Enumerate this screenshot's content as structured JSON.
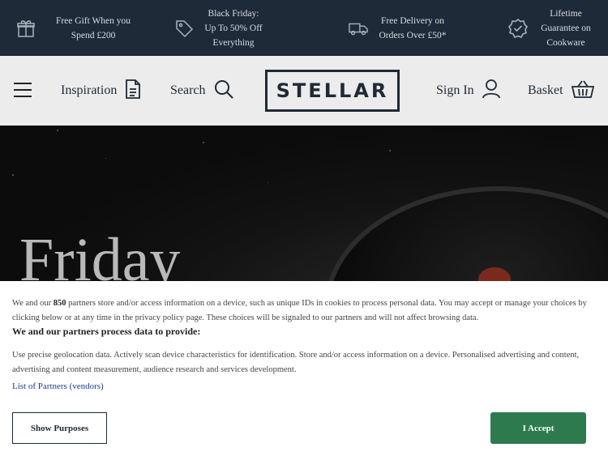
{
  "promo": {
    "items": [
      {
        "text": "Free Gift When you\nSpend £200",
        "icon": "gift-icon"
      },
      {
        "text": "Black Friday:\nUp To 50% Off\nEverything",
        "icon": "tag-icon"
      },
      {
        "text": "Free Delivery on\nOrders Over £50*",
        "icon": "truck-icon"
      },
      {
        "text": "Lifetime\nGuarantee on\nCookware",
        "icon": "badge-check-icon"
      }
    ]
  },
  "header": {
    "logo": "STELLAR",
    "inspiration_label": "Inspiration",
    "search_label": "Search",
    "signin_label": "Sign In",
    "basket_label": "Basket"
  },
  "hero": {
    "title": "Friday"
  },
  "consent": {
    "intro_pre": "We and our ",
    "intro_count": "850",
    "intro_post": " partners store and/or access information on a device, such as unique IDs in cookies to process personal data. You may accept or manage your choices by clicking below or at any time in the privacy policy page. These choices will be signaled to our partners and will not affect browsing data.",
    "heading": "We and our partners process data to provide:",
    "body": "Use precise geolocation data. Actively scan device characteristics for identification. Store and/or access information on a device. Personalised advertising and content, advertising and content measurement, audience research and services development.",
    "partners_link": "List of Partners (vendors)",
    "show_purposes": "Show Purposes",
    "accept": "I Accept"
  },
  "colors": {
    "promo_bg": "#1e2a38",
    "header_bg": "#ececec",
    "accept_green": "#2e7a4f",
    "link_blue": "#1b3c8c"
  }
}
